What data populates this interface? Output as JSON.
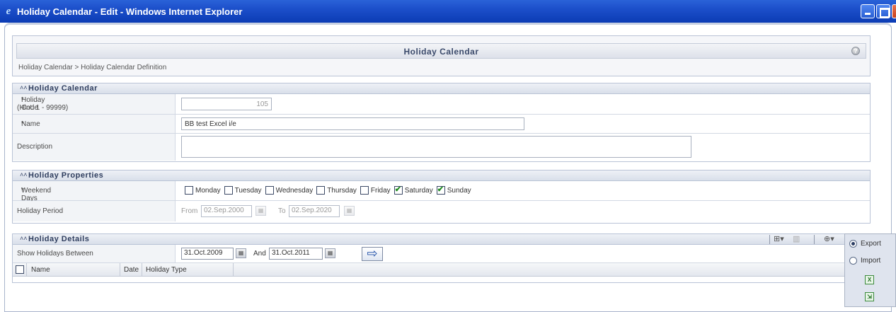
{
  "window": {
    "title": "Holiday Calendar - Edit - Windows Internet Explorer"
  },
  "page": {
    "header_title": "Holiday Calendar",
    "breadcrumb": "Holiday Calendar > Holiday Calendar Definition"
  },
  "sections": {
    "calendar": {
      "title": "Holiday Calendar",
      "holiday_code_label": "Holiday Code",
      "holiday_code_hint": "(Hint: 1 - 99999)",
      "holiday_code_value": "105",
      "name_label": "Name",
      "name_value": "BB test Excel i/e",
      "description_label": "Description",
      "description_value": ""
    },
    "properties": {
      "title": "Holiday Properties",
      "weekend_label": "Weekend Days",
      "days": [
        {
          "label": "Monday",
          "checked": false
        },
        {
          "label": "Tuesday",
          "checked": false
        },
        {
          "label": "Wednesday",
          "checked": false
        },
        {
          "label": "Thursday",
          "checked": false
        },
        {
          "label": "Friday",
          "checked": false
        },
        {
          "label": "Saturday",
          "checked": true
        },
        {
          "label": "Sunday",
          "checked": true
        }
      ],
      "period_label": "Holiday Period",
      "from_label": "From",
      "from_value": "02.Sep.2000",
      "to_label": "To",
      "to_value": "02.Sep.2020"
    },
    "details": {
      "title": "Holiday Details",
      "show_between_label": "Show Holidays Between",
      "start_date": "31.Oct.2009",
      "and_label": "And",
      "end_date": "31.Oct.2011",
      "columns": [
        "Name",
        "Date",
        "Holiday Type"
      ]
    }
  },
  "export_menu": {
    "export_label": "Export",
    "import_label": "Import",
    "selected": "Export"
  }
}
